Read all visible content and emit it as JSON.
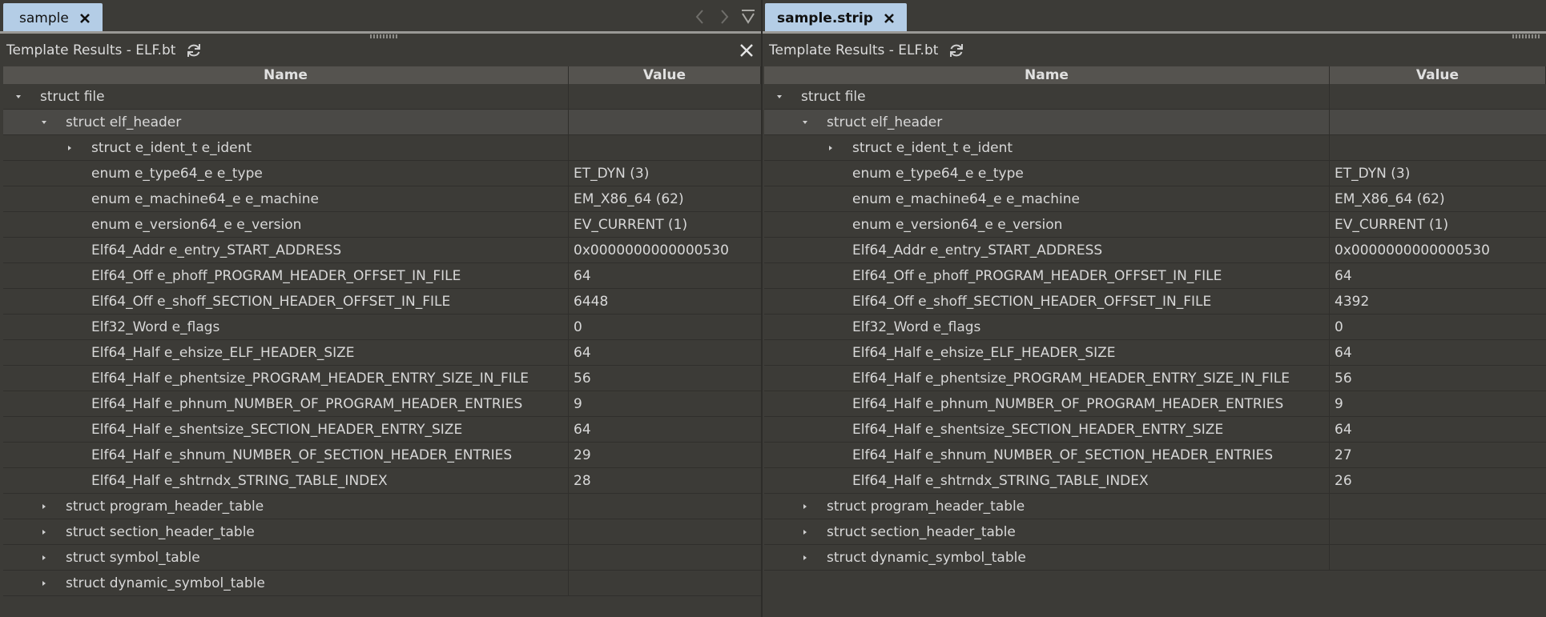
{
  "left": {
    "tab_label": "sample",
    "panel_title": "Template Results - ELF.bt",
    "columns": {
      "name": "Name",
      "value": "Value"
    },
    "rows": [
      {
        "name": "struct file",
        "value": ""
      },
      {
        "name": "struct elf_header",
        "value": ""
      },
      {
        "name": "struct e_ident_t e_ident",
        "value": ""
      },
      {
        "name": "enum e_type64_e e_type",
        "value": "ET_DYN (3)"
      },
      {
        "name": "enum e_machine64_e e_machine",
        "value": "EM_X86_64 (62)"
      },
      {
        "name": "enum e_version64_e e_version",
        "value": "EV_CURRENT (1)"
      },
      {
        "name": "Elf64_Addr e_entry_START_ADDRESS",
        "value": "0x0000000000000530"
      },
      {
        "name": "Elf64_Off e_phoff_PROGRAM_HEADER_OFFSET_IN_FILE",
        "value": "64"
      },
      {
        "name": "Elf64_Off e_shoff_SECTION_HEADER_OFFSET_IN_FILE",
        "value": "6448"
      },
      {
        "name": "Elf32_Word e_flags",
        "value": "0"
      },
      {
        "name": "Elf64_Half e_ehsize_ELF_HEADER_SIZE",
        "value": "64"
      },
      {
        "name": "Elf64_Half e_phentsize_PROGRAM_HEADER_ENTRY_SIZE_IN_FILE",
        "value": "56"
      },
      {
        "name": "Elf64_Half e_phnum_NUMBER_OF_PROGRAM_HEADER_ENTRIES",
        "value": "9"
      },
      {
        "name": "Elf64_Half e_shentsize_SECTION_HEADER_ENTRY_SIZE",
        "value": "64"
      },
      {
        "name": "Elf64_Half e_shnum_NUMBER_OF_SECTION_HEADER_ENTRIES",
        "value": "29"
      },
      {
        "name": "Elf64_Half e_shtrndx_STRING_TABLE_INDEX",
        "value": "28"
      },
      {
        "name": "struct program_header_table",
        "value": ""
      },
      {
        "name": "struct section_header_table",
        "value": ""
      },
      {
        "name": "struct symbol_table",
        "value": ""
      },
      {
        "name": "struct dynamic_symbol_table",
        "value": ""
      }
    ]
  },
  "right": {
    "tab_label": "sample.strip",
    "panel_title": "Template Results - ELF.bt",
    "columns": {
      "name": "Name",
      "value": "Value"
    },
    "rows": [
      {
        "name": "struct file",
        "value": ""
      },
      {
        "name": "struct elf_header",
        "value": ""
      },
      {
        "name": "struct e_ident_t e_ident",
        "value": ""
      },
      {
        "name": "enum e_type64_e e_type",
        "value": "ET_DYN (3)"
      },
      {
        "name": "enum e_machine64_e e_machine",
        "value": "EM_X86_64 (62)"
      },
      {
        "name": "enum e_version64_e e_version",
        "value": "EV_CURRENT (1)"
      },
      {
        "name": "Elf64_Addr e_entry_START_ADDRESS",
        "value": "0x0000000000000530"
      },
      {
        "name": "Elf64_Off e_phoff_PROGRAM_HEADER_OFFSET_IN_FILE",
        "value": "64"
      },
      {
        "name": "Elf64_Off e_shoff_SECTION_HEADER_OFFSET_IN_FILE",
        "value": "4392"
      },
      {
        "name": "Elf32_Word e_flags",
        "value": "0"
      },
      {
        "name": "Elf64_Half e_ehsize_ELF_HEADER_SIZE",
        "value": "64"
      },
      {
        "name": "Elf64_Half e_phentsize_PROGRAM_HEADER_ENTRY_SIZE_IN_FILE",
        "value": "56"
      },
      {
        "name": "Elf64_Half e_phnum_NUMBER_OF_PROGRAM_HEADER_ENTRIES",
        "value": "9"
      },
      {
        "name": "Elf64_Half e_shentsize_SECTION_HEADER_ENTRY_SIZE",
        "value": "64"
      },
      {
        "name": "Elf64_Half e_shnum_NUMBER_OF_SECTION_HEADER_ENTRIES",
        "value": "27"
      },
      {
        "name": "Elf64_Half e_shtrndx_STRING_TABLE_INDEX",
        "value": "26"
      },
      {
        "name": "struct program_header_table",
        "value": ""
      },
      {
        "name": "struct section_header_table",
        "value": ""
      },
      {
        "name": "struct dynamic_symbol_table",
        "value": ""
      }
    ]
  },
  "icons": {
    "tab_close": "close-icon",
    "refresh": "refresh-icon",
    "nav_back": "chevron-left-icon",
    "nav_forward": "chevron-right-icon",
    "tab_list": "tab-list-icon",
    "expand": "triangle-right-icon",
    "collapse": "triangle-down-icon"
  },
  "colors": {
    "background": "#3c3b37",
    "tab_active": "#b4cde6",
    "selected_row": "#4a4946",
    "header_row": "#55534f"
  }
}
